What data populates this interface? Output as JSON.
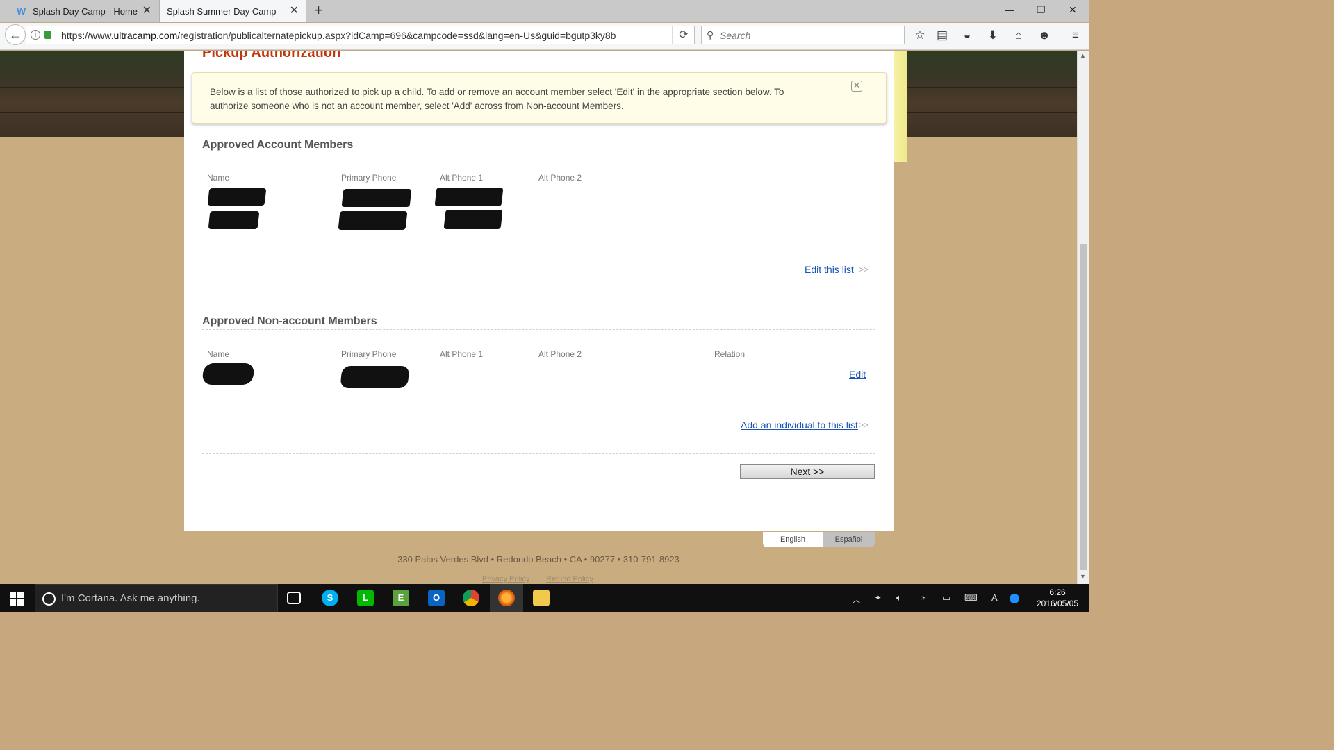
{
  "browser": {
    "tabs": [
      {
        "title": "Splash Day Camp - Home",
        "active": false,
        "favicon": "W"
      },
      {
        "title": "Splash Summer Day Camp",
        "active": true
      }
    ],
    "url_prefix": "https://www.",
    "url_domain": "ultracamp.com",
    "url_path": "/registration/publicalternatepickup.aspx?idCamp=696&campcode=ssd&lang=en-Us&guid=bgutp3ky8b",
    "search_placeholder": "Search"
  },
  "page": {
    "heading": "Pickup Authorization",
    "notice": "Below is a list of those authorized to pick up a child.  To add or remove an account member select 'Edit' in the appropriate section below.  To authorize someone who is not an account member, select 'Add' across from Non-account Members.",
    "account_section": {
      "title": "Approved Account Members",
      "columns": [
        "Name",
        "Primary Phone",
        "Alt Phone 1",
        "Alt Phone 2"
      ],
      "rows_redacted": 2,
      "edit_link": "Edit this list",
      "arrow": ">>"
    },
    "nonaccount_section": {
      "title": "Approved Non-account Members",
      "columns": [
        "Name",
        "Primary Phone",
        "Alt Phone 1",
        "Alt Phone 2",
        "Relation"
      ],
      "rows_redacted": 1,
      "row_edit_link": "Edit",
      "add_link": "Add an individual to this list",
      "arrow": ">>"
    },
    "next_button": "Next >>",
    "languages": [
      "English",
      "Español"
    ],
    "selected_language": "English",
    "address": "330 Palos Verdes Blvd • Redondo Beach • CA • 90277 • 310-791-8923",
    "footer_links": [
      "Privacy Policy",
      "Refund Policy"
    ]
  },
  "taskbar": {
    "cortana_placeholder": "I'm Cortana. Ask me anything.",
    "time": "6:26",
    "date": "2016/05/05",
    "apps": [
      "task-view",
      "skype",
      "line",
      "evernote",
      "outlook",
      "chrome",
      "firefox",
      "file-explorer"
    ]
  },
  "colors": {
    "heading": "#c0360f",
    "link": "#1a54b6",
    "notice_bg": "#fffde8",
    "page_bg": "#c9ac80"
  }
}
